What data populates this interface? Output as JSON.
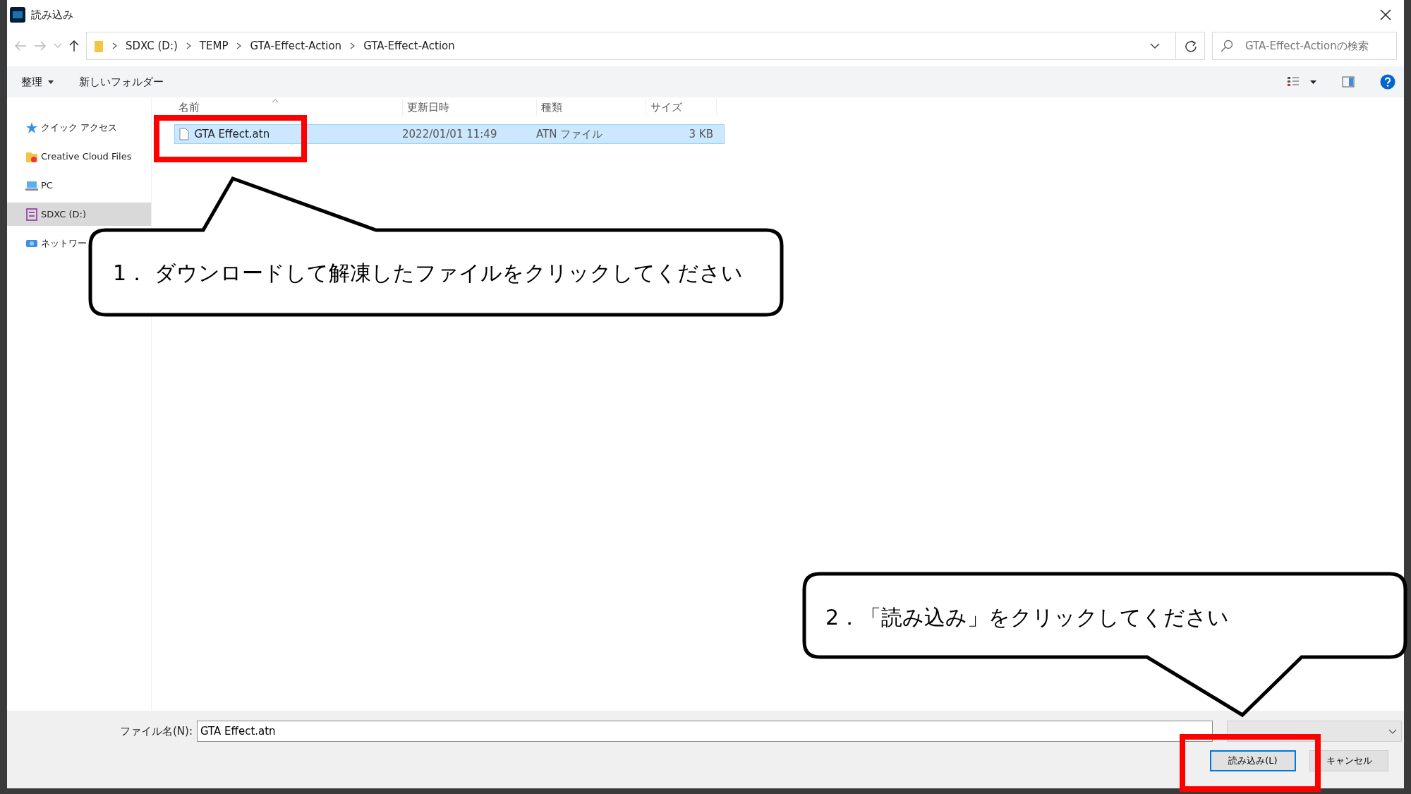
{
  "window": {
    "title": "読み込み"
  },
  "address_bar": {
    "path": [
      "SDXC (D:)",
      "TEMP",
      "GTA-Effect-Action",
      "GTA-Effect-Action"
    ]
  },
  "search": {
    "placeholder": "GTA-Effect-Actionの検索"
  },
  "toolbar": {
    "organize": "整理",
    "new_folder": "新しいフォルダー"
  },
  "sidebar": {
    "items": [
      {
        "label": "クイック アクセス",
        "kind": "star",
        "selected": false
      },
      {
        "label": "Creative Cloud Files",
        "kind": "folder",
        "selected": false
      },
      {
        "label": "PC",
        "kind": "pc",
        "selected": false
      },
      {
        "label": "SDXC (D:)",
        "kind": "sd",
        "selected": true
      },
      {
        "label": "ネットワー",
        "kind": "network",
        "selected": false
      }
    ]
  },
  "table": {
    "columns": [
      "名前",
      "更新日時",
      "種類",
      "サイズ"
    ],
    "rows": [
      {
        "cells": [
          "GTA Effect.atn",
          "2022/01/01 11:49",
          "ATN ファイル",
          "3 KB"
        ],
        "selected": true
      }
    ]
  },
  "filename": {
    "label": "ファイル名(N):",
    "value": "GTA Effect.atn"
  },
  "buttons": [
    {
      "label": "読み込み(L)",
      "kind": "default"
    },
    {
      "label": "キャンセル",
      "kind": "normal"
    }
  ],
  "callouts": [
    {
      "text": "1． ダウンロードして解凍したファイルをクリックしてください"
    },
    {
      "text": "2．「読み込み」をクリックしてください"
    }
  ]
}
